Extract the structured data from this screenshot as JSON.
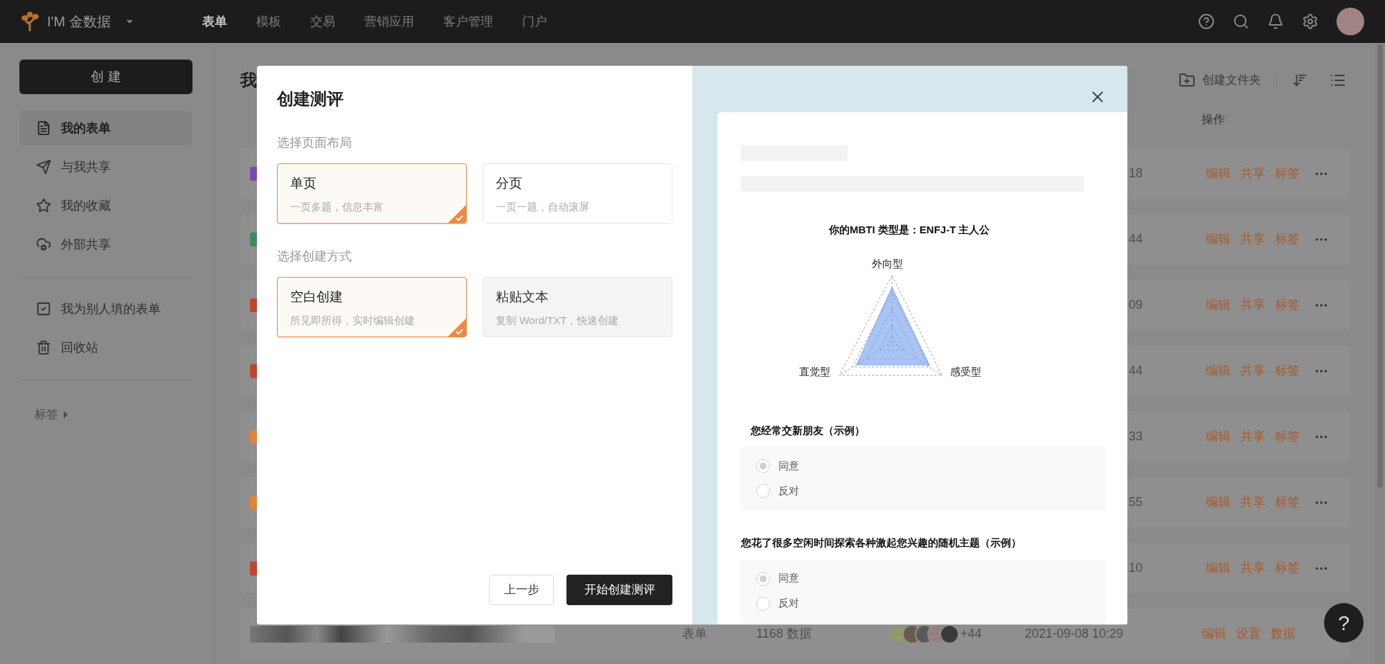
{
  "topbar": {
    "brand": "I'M 金数据",
    "nav": [
      {
        "label": "表单",
        "selected": true
      },
      {
        "label": "模板",
        "selected": false
      },
      {
        "label": "交易",
        "selected": false
      },
      {
        "label": "营销应用",
        "selected": false
      },
      {
        "label": "客户管理",
        "selected": false
      },
      {
        "label": "门户",
        "selected": false
      }
    ]
  },
  "sidebar": {
    "create_button": "创 建",
    "groups": [
      [
        {
          "label": "我的表单",
          "selected": true
        },
        {
          "label": "与我共享",
          "selected": false
        },
        {
          "label": "我的收藏",
          "selected": false
        },
        {
          "label": "外部共享",
          "selected": false
        }
      ],
      [
        {
          "label": "我为别人填的表单",
          "selected": false
        },
        {
          "label": "回收站",
          "selected": false
        }
      ]
    ],
    "tags": "标签"
  },
  "main": {
    "heading": "我",
    "new_folder": "创建文件夹",
    "column_ops": "操作",
    "rows": [
      {
        "color": "#7b4bb0",
        "time": "18",
        "actions": [
          "编辑",
          "共享",
          "标签"
        ]
      },
      {
        "color": "#3f8a5a",
        "time": "44",
        "actions": [
          "编辑",
          "共享",
          "标签"
        ]
      },
      {
        "color": "#c0462f",
        "time": "09",
        "actions": [
          "编辑",
          "共享",
          "标签"
        ]
      },
      {
        "color": "#c0462f",
        "time": "44",
        "actions": [
          "编辑",
          "共享",
          "标签"
        ]
      },
      {
        "color": "#e0843a",
        "time": "33",
        "actions": [
          "编辑",
          "共享",
          "标签"
        ]
      },
      {
        "color": "#e0843a",
        "time": "55",
        "actions": [
          "编辑",
          "共享",
          "标签"
        ]
      },
      {
        "color": "#c0462f",
        "time": "10",
        "actions": [
          "编辑",
          "共享",
          "标签"
        ]
      }
    ],
    "last_row": {
      "type": "表单",
      "count": "1168 数据",
      "more_members": "+44",
      "time": "2021-09-08 10:29",
      "actions": [
        "编辑",
        "设置",
        "数据"
      ]
    }
  },
  "help_button": "?",
  "modal": {
    "title": "创建测评",
    "sections": [
      {
        "label": "选择页面布局",
        "options": [
          {
            "title": "单页",
            "desc": "一页多题，信息丰富",
            "selected": true,
            "disabled": false
          },
          {
            "title": "分页",
            "desc": "一页一题，自动滚屏",
            "selected": false,
            "disabled": false
          }
        ]
      },
      {
        "label": "选择创建方式",
        "options": [
          {
            "title": "空白创建",
            "desc": "所见即所得，实时编辑创建",
            "selected": true,
            "disabled": false
          },
          {
            "title": "粘贴文本",
            "desc": "复制 Word/TXT，快速创建",
            "selected": false,
            "disabled": true
          }
        ]
      }
    ],
    "back_button": "上一步",
    "start_button": "开始创建测评",
    "preview": {
      "result_title": "你的MBTI 类型是：ENFJ-T 主人公",
      "axes": [
        "外向型",
        "直觉型",
        "感受型"
      ],
      "questions": [
        {
          "text": "您经常交新朋友（示例）",
          "options": [
            {
              "label": "同意",
              "selected": true
            },
            {
              "label": "反对",
              "selected": false
            }
          ]
        },
        {
          "text": "您花了很多空闲时间探索各种激起您兴趣的随机主题（示例）",
          "options": [
            {
              "label": "同意",
              "selected": true
            },
            {
              "label": "反对",
              "selected": false
            }
          ]
        }
      ]
    }
  }
}
